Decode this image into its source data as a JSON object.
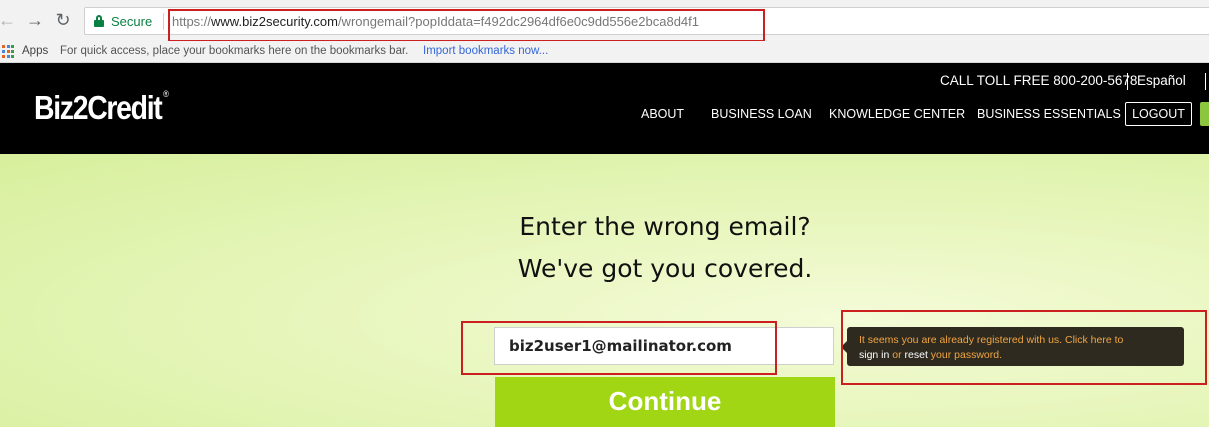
{
  "browser": {
    "back_icon": "arrow-left-icon",
    "forward_icon": "arrow-right-icon",
    "reload_icon": "reload-icon",
    "security_label": "Secure",
    "url_scheme": "https://",
    "url_host": "www.biz2security.com",
    "url_path": "/wrongemail?popIddata=f492dc2964df6e0c9dd556e2bca8d4f1"
  },
  "bookmarks": {
    "apps_label": "Apps",
    "hint": "For quick access, place your bookmarks here on the bookmarks bar.",
    "import_link": "Import bookmarks now..."
  },
  "header": {
    "logo_text": "Biz2Credit",
    "logo_mark": "®",
    "call": "CALL TOLL FREE 800-200-5678",
    "language": "Español",
    "nav": [
      "ABOUT",
      "BUSINESS LOAN",
      "KNOWLEDGE CENTER",
      "BUSINESS ESSENTIALS"
    ],
    "logout": "LOGOUT"
  },
  "hero": {
    "heading_line1": "Enter the wrong email?",
    "heading_line2": "We've got you covered.",
    "email_value": "biz2user1@mailinator.com",
    "continue_label": "Continue"
  },
  "tooltip": {
    "part1": "It seems you are already registered with us. Click here to",
    "sign_in": "sign in",
    "or": " or ",
    "reset": "reset",
    "part2": " your password."
  },
  "colors": {
    "annotation_red": "#cc1f1f",
    "brand_green": "#a0d613",
    "tooltip_bg": "#2e2a20",
    "tooltip_text": "#f2a541"
  }
}
